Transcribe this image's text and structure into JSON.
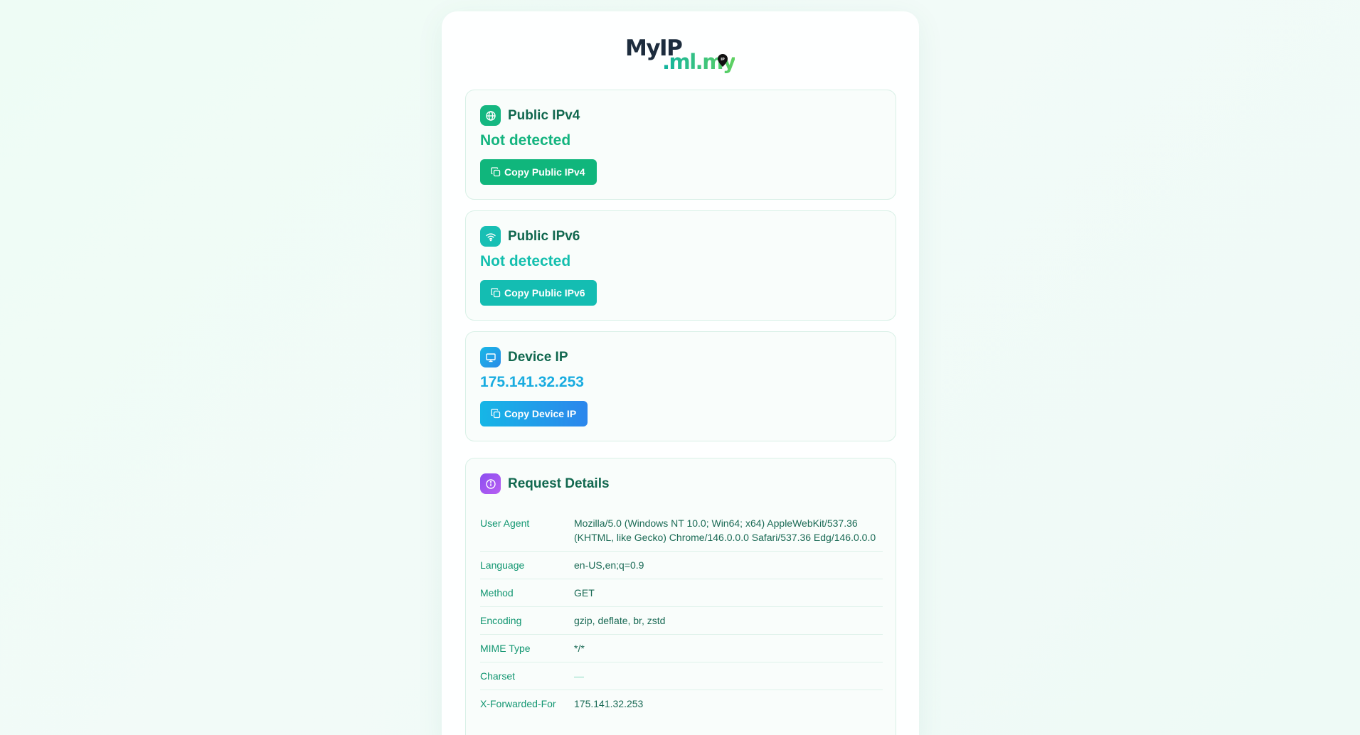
{
  "logo": {
    "main": "MyIP",
    "domain": ".ml.my",
    "pin": "IP"
  },
  "cards": [
    {
      "title": "Public IPv4",
      "value": "Not detected",
      "button": "Copy Public IPv4",
      "icon": "globe-icon"
    },
    {
      "title": "Public IPv6",
      "value": "Not detected",
      "button": "Copy Public IPv6",
      "icon": "wifi-icon"
    },
    {
      "title": "Device IP",
      "value": "175.141.32.253",
      "button": "Copy Device IP",
      "icon": "monitor-icon"
    }
  ],
  "details": {
    "title": "Request Details",
    "icon": "info-icon",
    "rows": [
      {
        "key": "User Agent",
        "value": "Mozilla/5.0 (Windows NT 10.0; Win64; x64) AppleWebKit/537.36 (KHTML, like Gecko) Chrome/146.0.0.0 Safari/537.36 Edg/146.0.0.0"
      },
      {
        "key": "Language",
        "value": "en-US,en;q=0.9"
      },
      {
        "key": "Method",
        "value": "GET"
      },
      {
        "key": "Encoding",
        "value": "gzip, deflate, br, zstd"
      },
      {
        "key": "MIME Type",
        "value": "*/*"
      },
      {
        "key": "Charset",
        "value": "—"
      },
      {
        "key": "X-Forwarded-For",
        "value": "175.141.32.253"
      }
    ]
  },
  "colors": {
    "green": "#10b67c",
    "teal": "#14bdb2",
    "blue": "#19ace0",
    "purple": "#8b4ff0"
  }
}
